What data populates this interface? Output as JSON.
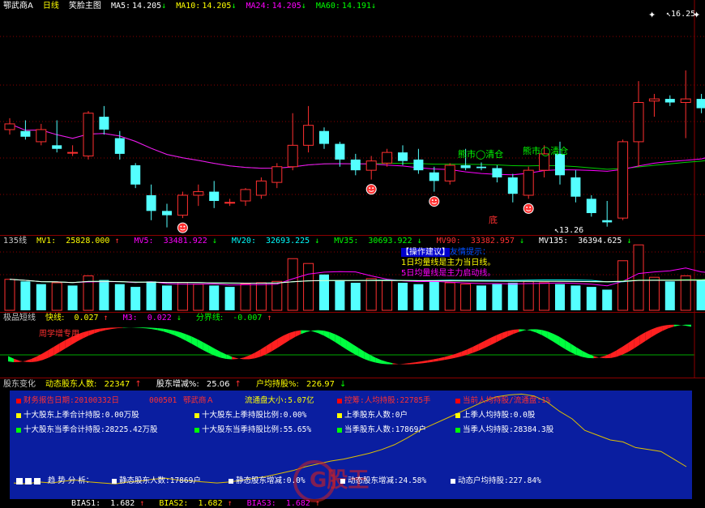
{
  "header": {
    "stock_name": "鄂武商A",
    "period": "日线",
    "mode": "笑脸主图",
    "ma": [
      {
        "label": "MA5:",
        "value": "14.205",
        "color": "#ffffff"
      },
      {
        "label": "MA10:",
        "value": "14.205",
        "color": "#ffff00"
      },
      {
        "label": "MA24:",
        "value": "14.205",
        "color": "#ff00ff"
      },
      {
        "label": "MA60:",
        "value": "14.191",
        "color": "#00ff00"
      }
    ],
    "arrow_down": "↓",
    "arrow_up": "↑"
  },
  "main": {
    "high_label": "16.25",
    "low_label": "13.26",
    "annotations": [
      "熊市◯清仓",
      "熊市◯清仓",
      "底"
    ]
  },
  "vol": {
    "title": "135线",
    "items": [
      {
        "label": "MV1:",
        "value": "25828.000",
        "arrow": "↑",
        "color": "#ffff00"
      },
      {
        "label": "MV5:",
        "value": "33481.922",
        "arrow": "↓",
        "color": "#ff00ff"
      },
      {
        "label": "MV20:",
        "value": "32693.225",
        "arrow": "↓",
        "color": "#00ffff"
      },
      {
        "label": "MV35:",
        "value": "30693.922",
        "arrow": "↓",
        "color": "#00ff00"
      },
      {
        "label": "MV90:",
        "value": "33382.957",
        "arrow": "↓",
        "color": "#ff3030"
      },
      {
        "label": "MV135:",
        "value": "36394.625",
        "arrow": "↓",
        "color": "#ffffff"
      }
    ],
    "tip_title": "【操作建议】",
    "tip_sub": "友情提示：",
    "tip1": "1日均量线是主力当日线。",
    "tip2": "5日均量线是主力启动线。"
  },
  "osc": {
    "title": "极品短线",
    "items": [
      {
        "label": "快线:",
        "value": "0.027",
        "arrow": "↑",
        "color": "#ffff00"
      },
      {
        "label": "M3:",
        "value": "0.022",
        "arrow": "↓",
        "color": "#ff00ff"
      },
      {
        "label": "分界线:",
        "value": "-0.007",
        "arrow": "↑",
        "color": "#00ff00"
      }
    ],
    "watermark": "周学增专用"
  },
  "holders": {
    "title": "股东变化",
    "items": [
      {
        "label": "动态股东人数:",
        "value": "22347",
        "arrow": "↑",
        "color": "#ffff00"
      },
      {
        "label": "股东增减%:",
        "value": "25.06",
        "arrow": "↑",
        "color": "#ffffff"
      },
      {
        "label": "户均持股%:",
        "value": "226.97",
        "arrow": "↓",
        "color": "#ffff00"
      }
    ],
    "rows": [
      [
        {
          "text": "财务报告日期:20100332日",
          "color": "#ff3030",
          "sq": "#ff0000"
        },
        {
          "text": "000501",
          "color": "#ff3030",
          "sq": ""
        },
        {
          "text": "鄂武商Ａ",
          "color": "#ff3030",
          "sq": ""
        },
        {
          "text": "流通盘大小:5.07亿",
          "color": "#ffff00",
          "sq": ""
        },
        {
          "text": "控筹:人均持股:22785手",
          "color": "#ff3030",
          "sq": "#ff0000"
        },
        {
          "text": "当前人均持股/流通盘:1%",
          "color": "#ff3030",
          "sq": "#ff0000"
        }
      ],
      [
        {
          "text": "十大股东上季合计持股:0.00万股",
          "color": "#ffffff",
          "sq": "#ffff00"
        },
        {
          "text": "十大股东上季持股比例:0.00%",
          "color": "#ffffff",
          "sq": "#ffff00"
        },
        {
          "text": "上季股东人数:0户",
          "color": "#ffffff",
          "sq": "#ffff00"
        },
        {
          "text": "上季人均持股:0.0股",
          "color": "#ffffff",
          "sq": "#ffff00"
        }
      ],
      [
        {
          "text": "十大股东当季合计持股:28225.42万股",
          "color": "#ffffff",
          "sq": "#00ff00"
        },
        {
          "text": "十大股东当季持股比例:55.65%",
          "color": "#ffffff",
          "sq": "#00ff00"
        },
        {
          "text": "当季股东人数:17869户",
          "color": "#ffffff",
          "sq": "#00ff00"
        },
        {
          "text": "当季人均持股:28384.3股",
          "color": "#ffffff",
          "sq": "#00ff00"
        }
      ]
    ],
    "trend_label": "趋 势 分 析：",
    "trend_items": [
      "静态股东人数:17869户",
      "静态股东增减:0.0%",
      "动态股东增减:24.58%",
      "动态户均持股:227.84%"
    ],
    "watermark": "G股王"
  },
  "bias": {
    "items": [
      {
        "label": "BIAS1:",
        "value": "1.682",
        "arrow": "↑"
      },
      {
        "label": "BIAS2:",
        "value": "1.682",
        "arrow": "↑"
      },
      {
        "label": "BIAS3:",
        "value": "1.682",
        "arrow": "↑"
      }
    ]
  },
  "candles": [
    [
      14.62,
      14.78,
      14.55,
      14.7
    ],
    [
      14.6,
      14.75,
      14.48,
      14.52
    ],
    [
      14.45,
      14.7,
      14.4,
      14.62
    ],
    [
      14.4,
      14.75,
      14.3,
      14.35
    ],
    [
      14.3,
      14.4,
      14.25,
      14.3
    ],
    [
      14.25,
      14.88,
      14.2,
      14.85
    ],
    [
      14.8,
      14.95,
      14.55,
      14.62
    ],
    [
      14.5,
      14.6,
      14.2,
      14.28
    ],
    [
      14.12,
      14.15,
      13.8,
      13.85
    ],
    [
      13.7,
      13.85,
      13.35,
      13.48
    ],
    [
      13.48,
      13.58,
      13.25,
      13.42
    ],
    [
      13.42,
      13.75,
      13.38,
      13.7
    ],
    [
      13.7,
      13.85,
      13.55,
      13.75
    ],
    [
      13.75,
      13.9,
      13.52,
      13.62
    ],
    [
      13.6,
      13.65,
      13.55,
      13.6
    ],
    [
      13.62,
      13.8,
      13.55,
      13.78
    ],
    [
      13.7,
      13.95,
      13.65,
      13.9
    ],
    [
      13.88,
      14.15,
      13.8,
      14.1
    ],
    [
      14.1,
      14.85,
      14.05,
      14.4
    ],
    [
      14.4,
      14.95,
      14.3,
      14.68
    ],
    [
      14.6,
      14.65,
      14.35,
      14.42
    ],
    [
      14.42,
      14.45,
      14.1,
      14.2
    ],
    [
      14.2,
      14.28,
      13.98,
      14.05
    ],
    [
      14.05,
      14.25,
      13.92,
      14.18
    ],
    [
      14.15,
      14.35,
      14.1,
      14.3
    ],
    [
      14.3,
      14.4,
      14.12,
      14.18
    ],
    [
      14.2,
      14.35,
      14.0,
      14.05
    ],
    [
      14.02,
      14.1,
      13.75,
      13.9
    ],
    [
      13.9,
      14.15,
      13.85,
      14.12
    ],
    [
      14.12,
      14.35,
      14.05,
      14.08
    ],
    [
      14.1,
      14.16,
      14.05,
      14.08
    ],
    [
      14.08,
      14.12,
      13.88,
      13.95
    ],
    [
      13.95,
      14.0,
      13.6,
      13.72
    ],
    [
      13.7,
      14.1,
      13.65,
      14.05
    ],
    [
      14.05,
      14.4,
      13.95,
      14.28
    ],
    [
      14.28,
      14.45,
      13.85,
      13.98
    ],
    [
      13.95,
      14.05,
      13.6,
      13.68
    ],
    [
      13.65,
      13.7,
      13.4,
      13.45
    ],
    [
      13.35,
      13.62,
      13.26,
      13.32
    ],
    [
      13.38,
      14.48,
      13.35,
      14.45
    ],
    [
      14.45,
      15.3,
      14.1,
      15.0
    ],
    [
      15.02,
      15.12,
      14.8,
      15.05
    ],
    [
      15.05,
      15.1,
      14.95,
      15.0
    ],
    [
      15.0,
      15.45,
      14.5,
      15.05
    ],
    [
      15.05,
      15.12,
      14.85,
      14.92
    ],
    [
      15.02,
      15.6,
      14.9,
      15.6
    ],
    [
      15.48,
      16.25,
      14.98,
      16.0
    ]
  ],
  "volumes": [
    [
      45,
      0
    ],
    [
      42,
      1
    ],
    [
      38,
      1
    ],
    [
      40,
      0
    ],
    [
      36,
      1
    ],
    [
      50,
      0
    ],
    [
      44,
      1
    ],
    [
      38,
      1
    ],
    [
      34,
      1
    ],
    [
      42,
      1
    ],
    [
      36,
      1
    ],
    [
      40,
      0
    ],
    [
      38,
      0
    ],
    [
      36,
      1
    ],
    [
      34,
      1
    ],
    [
      38,
      0
    ],
    [
      40,
      0
    ],
    [
      42,
      0
    ],
    [
      75,
      0
    ],
    [
      68,
      0
    ],
    [
      52,
      1
    ],
    [
      44,
      1
    ],
    [
      40,
      1
    ],
    [
      46,
      0
    ],
    [
      44,
      0
    ],
    [
      40,
      1
    ],
    [
      38,
      1
    ],
    [
      42,
      1
    ],
    [
      40,
      0
    ],
    [
      38,
      0
    ],
    [
      36,
      1
    ],
    [
      38,
      1
    ],
    [
      40,
      1
    ],
    [
      42,
      0
    ],
    [
      40,
      0
    ],
    [
      38,
      1
    ],
    [
      36,
      1
    ],
    [
      34,
      1
    ],
    [
      30,
      1
    ],
    [
      72,
      0
    ],
    [
      95,
      0
    ],
    [
      48,
      0
    ],
    [
      42,
      1
    ],
    [
      50,
      0
    ],
    [
      44,
      1
    ],
    [
      85,
      0
    ],
    [
      70,
      0
    ]
  ],
  "holder_curve": [
    0.05,
    0.04,
    0.06,
    0.05,
    0.07,
    0.08,
    0.06,
    0.05,
    0.04,
    0.06,
    0.07,
    0.09,
    0.1,
    0.08,
    0.07,
    0.06,
    0.05,
    0.06,
    0.08,
    0.1,
    0.12,
    0.15,
    0.18,
    0.22,
    0.25,
    0.28,
    0.3,
    0.33,
    0.36,
    0.4,
    0.45,
    0.52,
    0.6,
    0.66,
    0.72,
    0.78,
    0.84,
    0.9,
    0.95,
    0.97,
    0.98,
    0.96,
    0.9,
    0.8,
    0.72,
    0.6,
    0.55,
    0.5,
    0.48,
    0.42,
    0.4,
    0.38,
    0.3,
    0.22
  ]
}
